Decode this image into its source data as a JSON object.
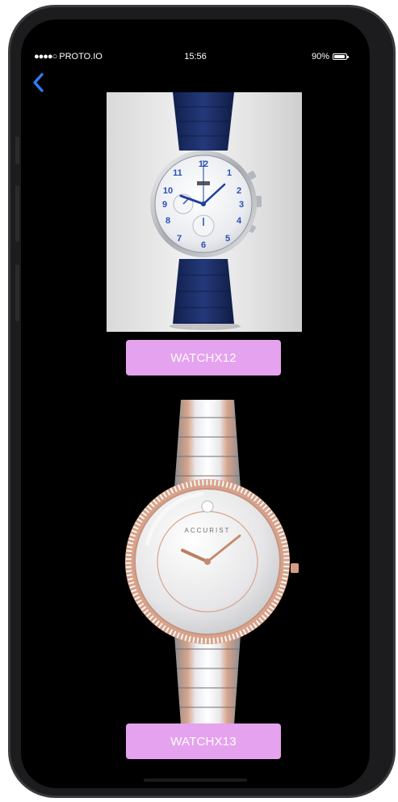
{
  "status_bar": {
    "signal": "●●●●○",
    "carrier": "PROTO.IO",
    "time": "15:56",
    "battery": "90%",
    "battery_level": 0.9
  },
  "nav": {
    "back_icon": "chevron-left-icon"
  },
  "products": [
    {
      "label": "WATCHX12",
      "image": "blue-leather-chronograph-watch"
    },
    {
      "label": "WATCHX13",
      "image": "two-tone-crystal-bezel-watch",
      "dial_brand": "ACCURIST"
    }
  ],
  "colors": {
    "screen_bg": "#000000",
    "button_bg": "#e5a2ee",
    "button_text": "#ffffff",
    "back_icon": "#2f7bf5"
  }
}
